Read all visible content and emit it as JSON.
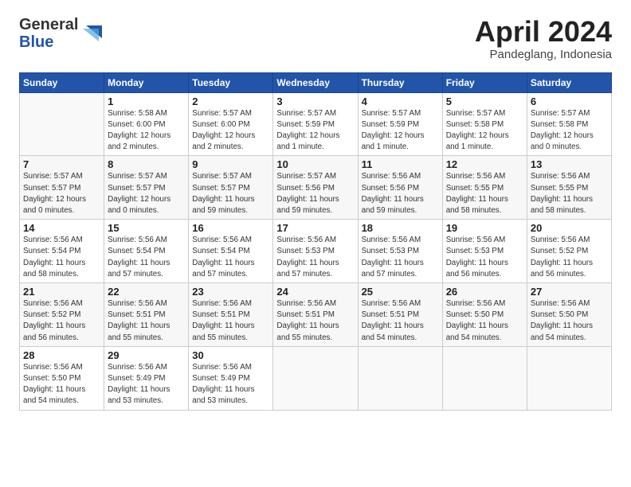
{
  "logo": {
    "general": "General",
    "blue": "Blue"
  },
  "title": "April 2024",
  "subtitle": "Pandeglang, Indonesia",
  "days_header": [
    "Sunday",
    "Monday",
    "Tuesday",
    "Wednesday",
    "Thursday",
    "Friday",
    "Saturday"
  ],
  "weeks": [
    [
      {
        "day": "",
        "info": ""
      },
      {
        "day": "1",
        "info": "Sunrise: 5:58 AM\nSunset: 6:00 PM\nDaylight: 12 hours\nand 2 minutes."
      },
      {
        "day": "2",
        "info": "Sunrise: 5:57 AM\nSunset: 6:00 PM\nDaylight: 12 hours\nand 2 minutes."
      },
      {
        "day": "3",
        "info": "Sunrise: 5:57 AM\nSunset: 5:59 PM\nDaylight: 12 hours\nand 1 minute."
      },
      {
        "day": "4",
        "info": "Sunrise: 5:57 AM\nSunset: 5:59 PM\nDaylight: 12 hours\nand 1 minute."
      },
      {
        "day": "5",
        "info": "Sunrise: 5:57 AM\nSunset: 5:58 PM\nDaylight: 12 hours\nand 1 minute."
      },
      {
        "day": "6",
        "info": "Sunrise: 5:57 AM\nSunset: 5:58 PM\nDaylight: 12 hours\nand 0 minutes."
      }
    ],
    [
      {
        "day": "7",
        "info": "Sunrise: 5:57 AM\nSunset: 5:57 PM\nDaylight: 12 hours\nand 0 minutes."
      },
      {
        "day": "8",
        "info": "Sunrise: 5:57 AM\nSunset: 5:57 PM\nDaylight: 12 hours\nand 0 minutes."
      },
      {
        "day": "9",
        "info": "Sunrise: 5:57 AM\nSunset: 5:57 PM\nDaylight: 11 hours\nand 59 minutes."
      },
      {
        "day": "10",
        "info": "Sunrise: 5:57 AM\nSunset: 5:56 PM\nDaylight: 11 hours\nand 59 minutes."
      },
      {
        "day": "11",
        "info": "Sunrise: 5:56 AM\nSunset: 5:56 PM\nDaylight: 11 hours\nand 59 minutes."
      },
      {
        "day": "12",
        "info": "Sunrise: 5:56 AM\nSunset: 5:55 PM\nDaylight: 11 hours\nand 58 minutes."
      },
      {
        "day": "13",
        "info": "Sunrise: 5:56 AM\nSunset: 5:55 PM\nDaylight: 11 hours\nand 58 minutes."
      }
    ],
    [
      {
        "day": "14",
        "info": "Sunrise: 5:56 AM\nSunset: 5:54 PM\nDaylight: 11 hours\nand 58 minutes."
      },
      {
        "day": "15",
        "info": "Sunrise: 5:56 AM\nSunset: 5:54 PM\nDaylight: 11 hours\nand 57 minutes."
      },
      {
        "day": "16",
        "info": "Sunrise: 5:56 AM\nSunset: 5:54 PM\nDaylight: 11 hours\nand 57 minutes."
      },
      {
        "day": "17",
        "info": "Sunrise: 5:56 AM\nSunset: 5:53 PM\nDaylight: 11 hours\nand 57 minutes."
      },
      {
        "day": "18",
        "info": "Sunrise: 5:56 AM\nSunset: 5:53 PM\nDaylight: 11 hours\nand 57 minutes."
      },
      {
        "day": "19",
        "info": "Sunrise: 5:56 AM\nSunset: 5:53 PM\nDaylight: 11 hours\nand 56 minutes."
      },
      {
        "day": "20",
        "info": "Sunrise: 5:56 AM\nSunset: 5:52 PM\nDaylight: 11 hours\nand 56 minutes."
      }
    ],
    [
      {
        "day": "21",
        "info": "Sunrise: 5:56 AM\nSunset: 5:52 PM\nDaylight: 11 hours\nand 56 minutes."
      },
      {
        "day": "22",
        "info": "Sunrise: 5:56 AM\nSunset: 5:51 PM\nDaylight: 11 hours\nand 55 minutes."
      },
      {
        "day": "23",
        "info": "Sunrise: 5:56 AM\nSunset: 5:51 PM\nDaylight: 11 hours\nand 55 minutes."
      },
      {
        "day": "24",
        "info": "Sunrise: 5:56 AM\nSunset: 5:51 PM\nDaylight: 11 hours\nand 55 minutes."
      },
      {
        "day": "25",
        "info": "Sunrise: 5:56 AM\nSunset: 5:51 PM\nDaylight: 11 hours\nand 54 minutes."
      },
      {
        "day": "26",
        "info": "Sunrise: 5:56 AM\nSunset: 5:50 PM\nDaylight: 11 hours\nand 54 minutes."
      },
      {
        "day": "27",
        "info": "Sunrise: 5:56 AM\nSunset: 5:50 PM\nDaylight: 11 hours\nand 54 minutes."
      }
    ],
    [
      {
        "day": "28",
        "info": "Sunrise: 5:56 AM\nSunset: 5:50 PM\nDaylight: 11 hours\nand 54 minutes."
      },
      {
        "day": "29",
        "info": "Sunrise: 5:56 AM\nSunset: 5:49 PM\nDaylight: 11 hours\nand 53 minutes."
      },
      {
        "day": "30",
        "info": "Sunrise: 5:56 AM\nSunset: 5:49 PM\nDaylight: 11 hours\nand 53 minutes."
      },
      {
        "day": "",
        "info": ""
      },
      {
        "day": "",
        "info": ""
      },
      {
        "day": "",
        "info": ""
      },
      {
        "day": "",
        "info": ""
      }
    ]
  ]
}
